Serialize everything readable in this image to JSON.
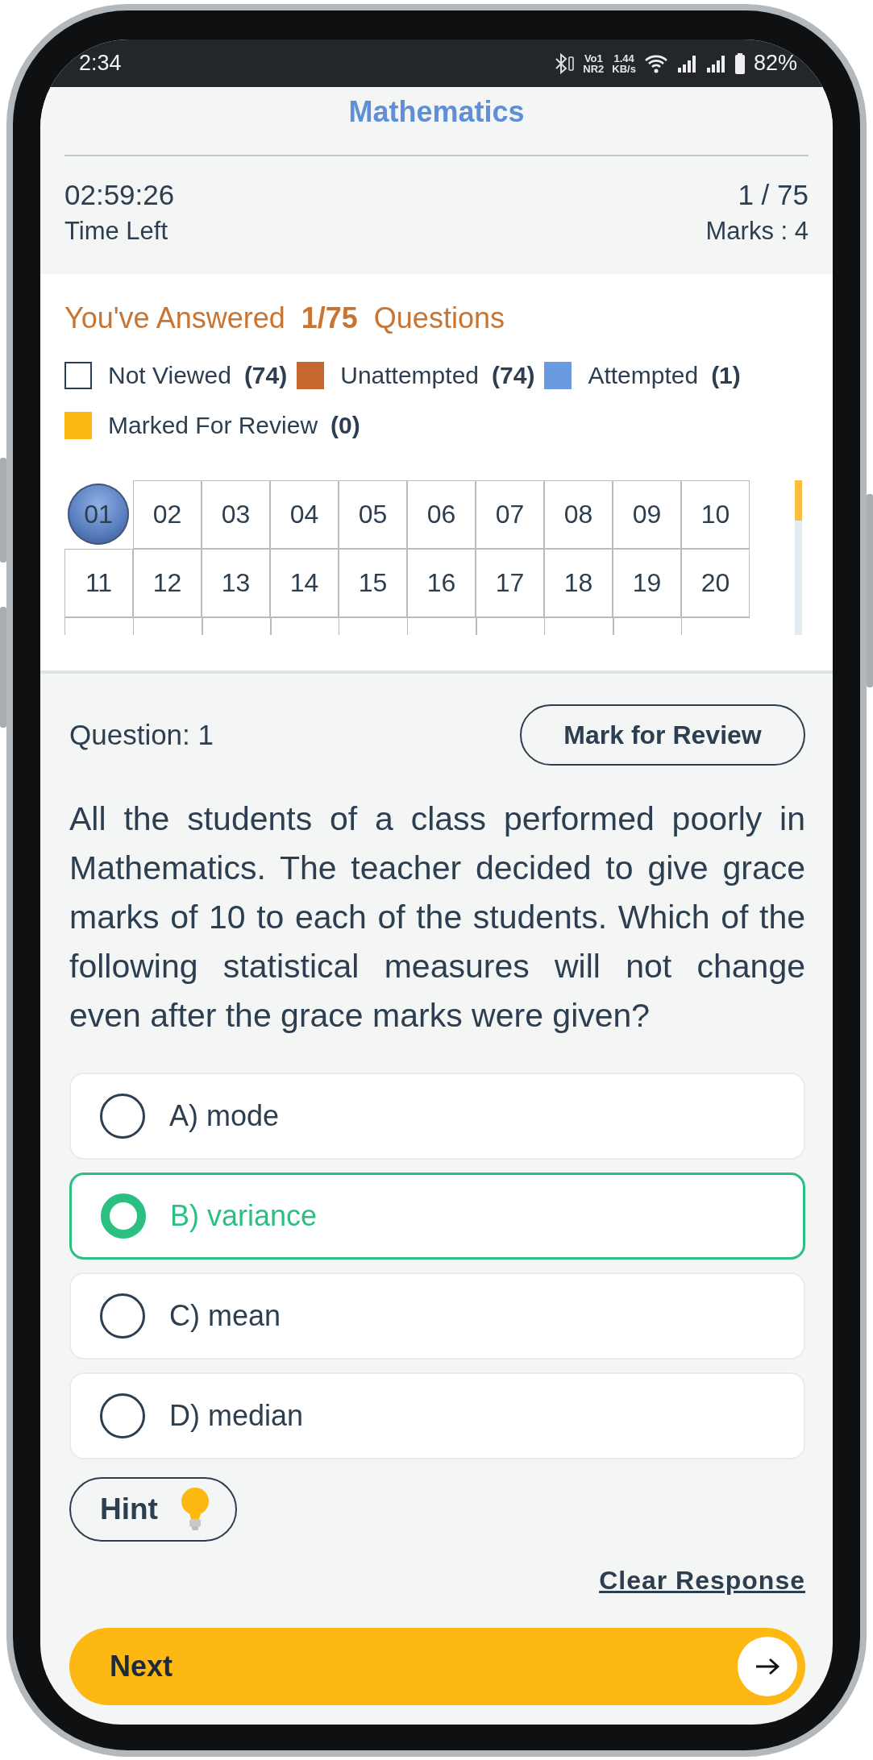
{
  "status_bar": {
    "time": "2:34",
    "sim_labels": [
      "Vo1",
      "NR2"
    ],
    "speed": [
      "1.44",
      "KB/s"
    ],
    "battery": "82%"
  },
  "header": {
    "title": "Mathematics",
    "timer": "02:59:26",
    "timer_label": "Time Left",
    "progress": "1 / 75",
    "marks": "Marks : 4"
  },
  "summary": {
    "prefix": "You've Answered",
    "count": "1/75",
    "suffix": "Questions"
  },
  "legend": [
    {
      "kind": "outline",
      "label": "Not Viewed",
      "count": "(74)",
      "color": "#2c3e50"
    },
    {
      "kind": "filled",
      "label": "Unattempted",
      "count": "(74)",
      "color": "#c5672f"
    },
    {
      "kind": "filled",
      "label": "Attempted",
      "count": "(1)",
      "color": "#6a9ae0"
    },
    {
      "kind": "filled",
      "label": "Marked For Review",
      "count": "(0)",
      "color": "#fdb813"
    }
  ],
  "palette": [
    {
      "label": "01",
      "selected": true
    },
    {
      "label": "02",
      "selected": false
    },
    {
      "label": "03",
      "selected": false
    },
    {
      "label": "04",
      "selected": false
    },
    {
      "label": "05",
      "selected": false
    },
    {
      "label": "06",
      "selected": false
    },
    {
      "label": "07",
      "selected": false
    },
    {
      "label": "08",
      "selected": false
    },
    {
      "label": "09",
      "selected": false
    },
    {
      "label": "10",
      "selected": false
    },
    {
      "label": "11",
      "selected": false
    },
    {
      "label": "12",
      "selected": false
    },
    {
      "label": "13",
      "selected": false
    },
    {
      "label": "14",
      "selected": false
    },
    {
      "label": "15",
      "selected": false
    },
    {
      "label": "16",
      "selected": false
    },
    {
      "label": "17",
      "selected": false
    },
    {
      "label": "18",
      "selected": false
    },
    {
      "label": "19",
      "selected": false
    },
    {
      "label": "20",
      "selected": false
    }
  ],
  "question": {
    "number": "Question: 1",
    "review_button": "Mark for Review",
    "text": "All the students of a class performed poorly in Mathematics. The teacher decided to give grace marks of 10 to each of the students. Which of the following statistical measures will not change even after the grace marks were given?"
  },
  "options": [
    {
      "label": "A) mode",
      "selected": false
    },
    {
      "label": "B) variance",
      "selected": true
    },
    {
      "label": "C) mean",
      "selected": false
    },
    {
      "label": "D) median",
      "selected": false
    }
  ],
  "hint_button": "Hint",
  "clear_link": "Clear Response",
  "next_button": "Next"
}
